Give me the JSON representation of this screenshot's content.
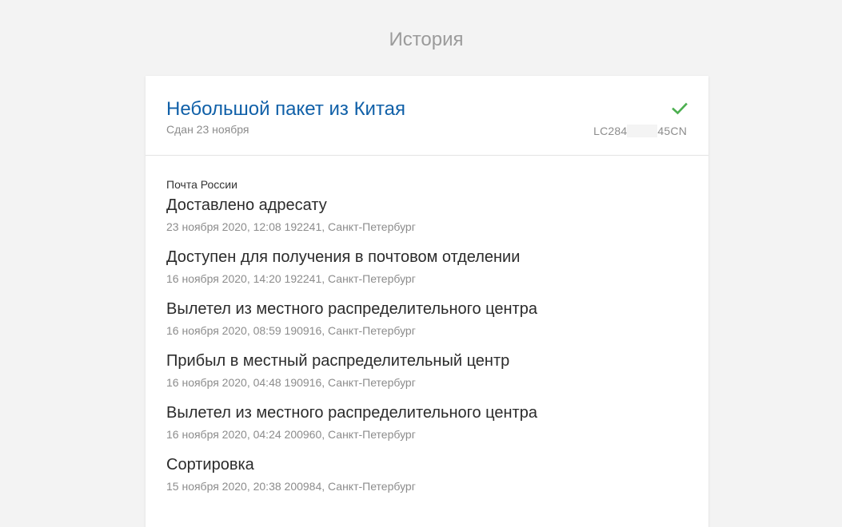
{
  "page": {
    "title": "История"
  },
  "parcel": {
    "title": "Небольшой пакет из Китая",
    "subtitle": "Сдан 23 ноября",
    "tracking_prefix": "LC284",
    "tracking_suffix": "45CN",
    "status_icon": "check-icon",
    "status_color": "#4caf50",
    "title_color": "#1060a8"
  },
  "history": {
    "carrier": "Почта России",
    "events": [
      {
        "status": "Доставлено адресату",
        "meta": "23 ноября 2020, 12:08 192241, Санкт-Петербург"
      },
      {
        "status": "Доступен для получения в почтовом отделении",
        "meta": "16 ноября 2020, 14:20 192241, Санкт-Петербург"
      },
      {
        "status": "Вылетел из местного распределительного центра",
        "meta": "16 ноября 2020, 08:59 190916, Санкт-Петербург"
      },
      {
        "status": "Прибыл в местный распределительный центр",
        "meta": "16 ноября 2020, 04:48 190916, Санкт-Петербург"
      },
      {
        "status": "Вылетел из местного распределительного центра",
        "meta": "16 ноября 2020, 04:24 200960, Санкт-Петербург"
      },
      {
        "status": "Сортировка",
        "meta": "15 ноября 2020, 20:38 200984, Санкт-Петербург"
      }
    ]
  }
}
